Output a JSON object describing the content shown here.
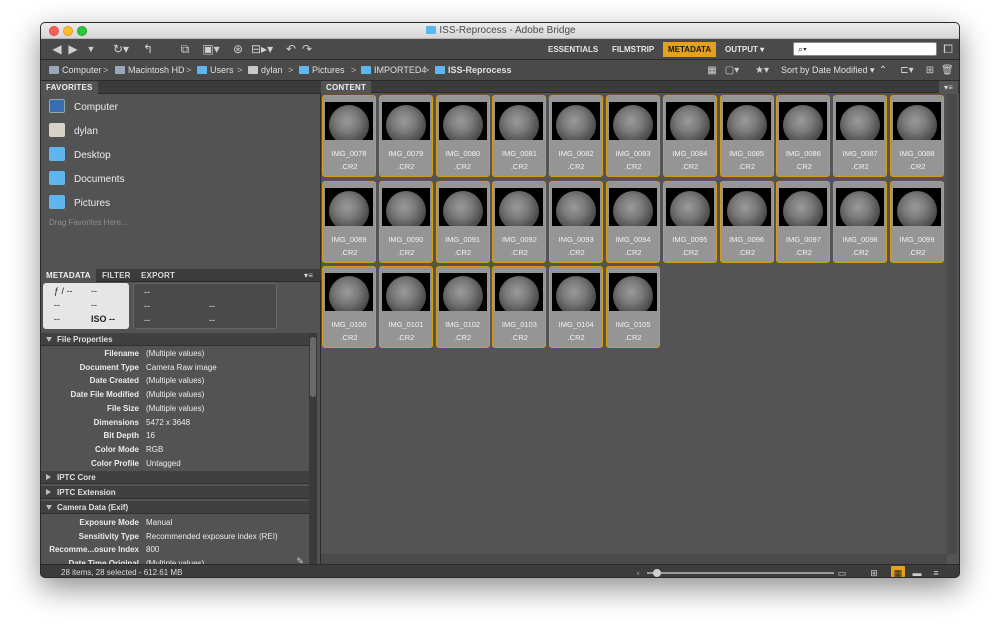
{
  "window": {
    "title": "ISS-Reprocess - Adobe Bridge"
  },
  "toolbar": {
    "workspaces": [
      {
        "label": "ESSENTIALS",
        "active": false
      },
      {
        "label": "FILMSTRIP",
        "active": false
      },
      {
        "label": "METADATA",
        "active": true
      },
      {
        "label": "OUTPUT ▾",
        "active": false
      }
    ],
    "search": {
      "placeholder": "⌕▾"
    }
  },
  "path": {
    "crumbs": [
      "Computer",
      "Macintosh HD",
      "Users",
      "dylan",
      "Pictures",
      "IMPORTED4",
      "ISS-Reprocess"
    ],
    "sort_label": "Sort by Date Modified ▾"
  },
  "favorites": {
    "tab_label": "FAVORITES",
    "items": [
      "Computer",
      "dylan",
      "Desktop",
      "Documents",
      "Pictures"
    ],
    "hint": "Drag Favorites Here..."
  },
  "metadata_panel": {
    "tabs": [
      "METADATA",
      "FILTER",
      "EXPORT"
    ],
    "card1": {
      "aperture": "ƒ / --",
      "shutter": "--",
      "r2l": "--",
      "r2r": "--",
      "r3l": "--",
      "iso": "ISO --"
    },
    "card2": {
      "r1": "--",
      "r2l": "--",
      "r2r": "--",
      "r3l": "--",
      "r3r": "--"
    },
    "sections": [
      {
        "title": "File Properties",
        "open": true
      },
      {
        "title": "IPTC Core",
        "open": false
      },
      {
        "title": "IPTC Extension",
        "open": false
      },
      {
        "title": "Camera Data (Exif)",
        "open": true
      }
    ],
    "file_properties": [
      {
        "key": "Filename",
        "value": "(Multiple values)"
      },
      {
        "key": "Document Type",
        "value": "Camera Raw image"
      },
      {
        "key": "Date Created",
        "value": "(Multiple values)"
      },
      {
        "key": "Date File Modified",
        "value": "(Multiple values)"
      },
      {
        "key": "File Size",
        "value": "(Multiple values)"
      },
      {
        "key": "Dimensions",
        "value": "5472 x 3648"
      },
      {
        "key": "Bit Depth",
        "value": "16"
      },
      {
        "key": "Color Mode",
        "value": "RGB"
      },
      {
        "key": "Color Profile",
        "value": "Untagged"
      }
    ],
    "camera_data": [
      {
        "key": "Exposure Mode",
        "value": "Manual"
      },
      {
        "key": "Sensitivity Type",
        "value": "Recommended exposure index (REI)"
      },
      {
        "key": "Recomme...osure Index",
        "value": "800"
      },
      {
        "key": "Date Time Original",
        "value": "(Multiple values)"
      }
    ]
  },
  "content": {
    "tab_label": "CONTENT",
    "files": [
      "IMG_0078",
      "IMG_0079",
      "IMG_0080",
      "IMG_0081",
      "IMG_0082",
      "IMG_0083",
      "IMG_0084",
      "IMG_0085",
      "IMG_0086",
      "IMG_0087",
      "IMG_0088",
      "IMG_0089",
      "IMG_0090",
      "IMG_0091",
      "IMG_0092",
      "IMG_0093",
      "IMG_0094",
      "IMG_0095",
      "IMG_0096",
      "IMG_0097",
      "IMG_0098",
      "IMG_0099",
      "IMG_0100",
      "IMG_0101",
      "IMG_0102",
      "IMG_0103",
      "IMG_0104",
      "IMG_0105"
    ],
    "extension": ".CR2"
  },
  "status": {
    "text": "28 items, 28 selected - 612.61 MB"
  },
  "colors": {
    "accent": "#e5a01d",
    "selection_border": "#d49a1b"
  }
}
